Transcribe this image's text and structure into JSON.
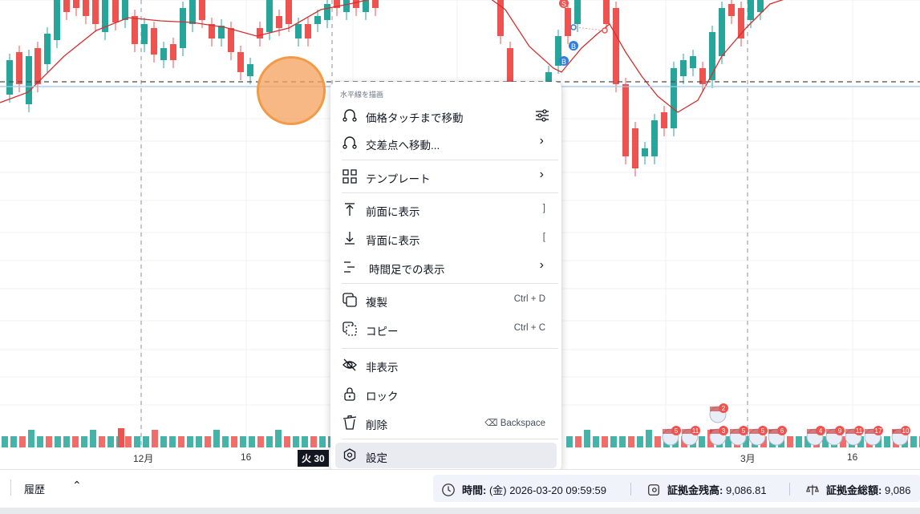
{
  "chart": {
    "x_labels": [
      "12月",
      "16",
      "火 30",
      "3月",
      "16"
    ],
    "colors": {
      "up": "#26a69a",
      "down": "#ef5350",
      "ma": "#d32f2f",
      "hline": "#4c4c4c"
    }
  },
  "markers": {
    "sell": "S",
    "buy": "B"
  },
  "event_counts": [
    "2",
    "5",
    "11",
    "3",
    "5",
    "5",
    "6",
    "4",
    "9",
    "11",
    "17",
    "10"
  ],
  "menu": {
    "header": "水平線を描画",
    "items": [
      {
        "label": "価格タッチまで移動",
        "icon": "price-touch-icon",
        "right": "settings"
      },
      {
        "label": "交差点へ移動...",
        "icon": "cross-point-icon",
        "right": "submenu"
      },
      {
        "label": "テンプレート",
        "icon": "template-grid-icon",
        "right": "submenu"
      },
      {
        "label": "前面に表示",
        "icon": "bring-front-icon",
        "shortcut": "]"
      },
      {
        "label": "背面に表示",
        "icon": "send-back-icon",
        "shortcut": "["
      },
      {
        "label": "時間足での表示",
        "icon": "timeframe-visibility-icon",
        "right": "submenu"
      },
      {
        "label": "複製",
        "icon": "clone-icon",
        "shortcut": "Ctrl + D"
      },
      {
        "label": "コピー",
        "icon": "copy-icon",
        "shortcut": "Ctrl + C"
      },
      {
        "label": "非表示",
        "icon": "eye-hidden-icon"
      },
      {
        "label": "ロック",
        "icon": "lock-icon"
      },
      {
        "label": "削除",
        "icon": "trash-icon",
        "shortcut": "⌫ Backspace"
      },
      {
        "label": "設定",
        "icon": "gear-icon"
      }
    ]
  },
  "bottombar": {
    "history": "履歴",
    "time_label": "時間:",
    "time_value": "(金) 2026-03-20 09:59:59",
    "balance_label": "証拠金残高:",
    "balance_value": "9,086.81",
    "equity_label": "証拠金総額:",
    "equity_value": "9,086"
  }
}
